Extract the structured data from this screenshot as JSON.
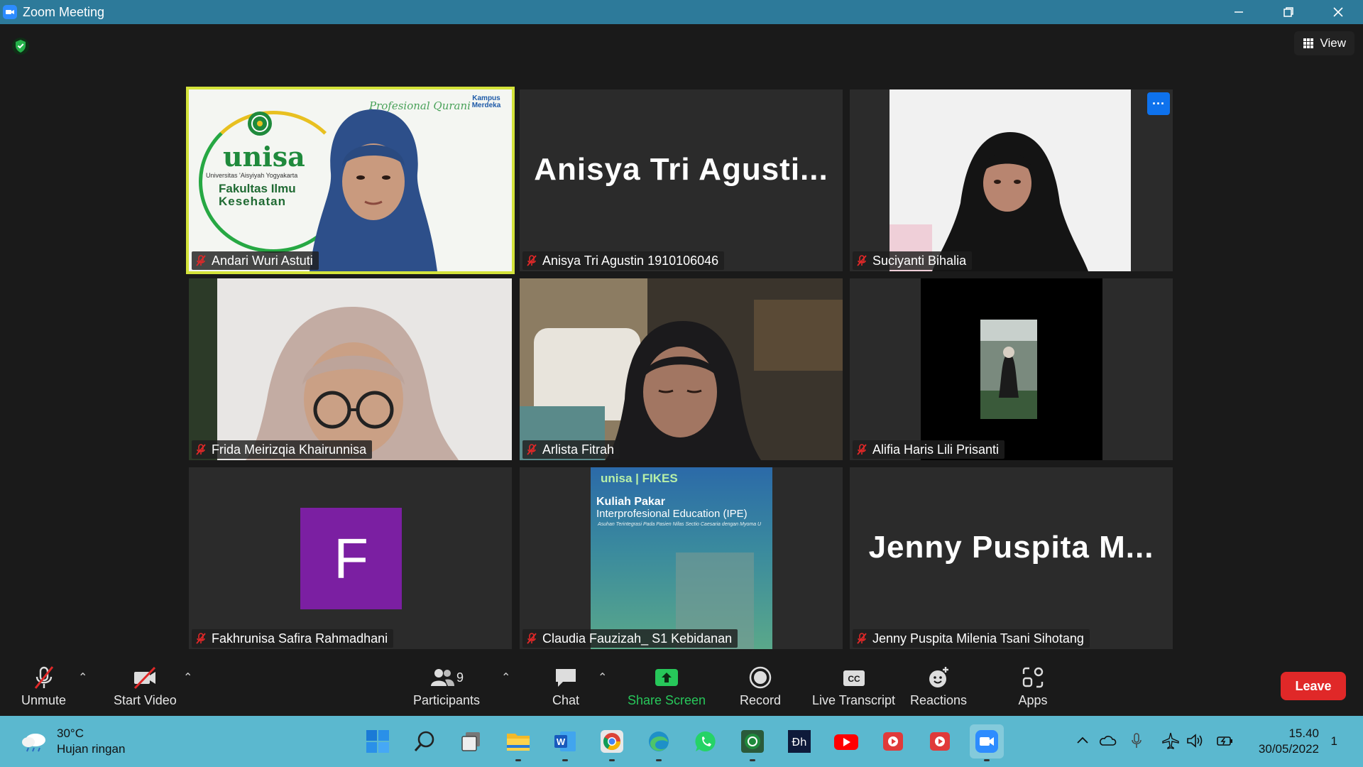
{
  "window": {
    "title": "Zoom Meeting"
  },
  "top": {
    "view_label": "View",
    "more_label": "···"
  },
  "tiles": [
    {
      "name": "Andari Wuri Astuti",
      "kind": "video",
      "active": true
    },
    {
      "name": "Anisya Tri Agustin 1910106046",
      "kind": "text",
      "display": "Anisya Tri Agusti..."
    },
    {
      "name": "Suciyanti Bihalia",
      "kind": "video"
    },
    {
      "name": "Frida Meirizqia Khairunnisa",
      "kind": "video"
    },
    {
      "name": "Arlista Fitrah",
      "kind": "video"
    },
    {
      "name": "Alifia Haris Lili Prisanti",
      "kind": "video"
    },
    {
      "name": "Fakhrunisa Safira Rahmadhani",
      "kind": "avatar",
      "initial": "F"
    },
    {
      "name": "Claudia Fauzizah_ S1 Kebidanan",
      "kind": "video"
    },
    {
      "name": "Jenny Puspita Milenia Tsani Sihotang",
      "kind": "text",
      "display": "Jenny Puspita M..."
    }
  ],
  "slide1": {
    "header": "Profesional Qurani",
    "badge": "Kampus Merdeka",
    "logo": "unisa",
    "university": "Universitas 'Aisyiyah Yogyakarta",
    "faculty_line1": "Fakultas Ilmu",
    "faculty_line2": "Kesehatan"
  },
  "slide2": {
    "brand": "unisa | FIKES",
    "title": "Kuliah Pakar",
    "subtitle": "Interprofesional Education (IPE)",
    "caption": "Asuhan Terintegrasi Pada Pasien Nifas Sectio Caesaria dengan Myoma U"
  },
  "toolbar": {
    "unmute": "Unmute",
    "start_video": "Start Video",
    "participants": "Participants",
    "participants_count": "9",
    "chat": "Chat",
    "share": "Share Screen",
    "record": "Record",
    "transcript": "Live Transcript",
    "reactions": "Reactions",
    "apps": "Apps",
    "leave": "Leave"
  },
  "taskbar": {
    "temp": "30°C",
    "weather": "Hujan ringan",
    "time": "15.40",
    "date": "30/05/2022",
    "notifications": "1"
  },
  "colors": {
    "titlebar": "#2d7a9a",
    "active_border": "#d4e33a",
    "leave": "#e02828",
    "share": "#27c75a",
    "avatar": "#7b1fa2",
    "taskbar": "#5bb8cf"
  }
}
